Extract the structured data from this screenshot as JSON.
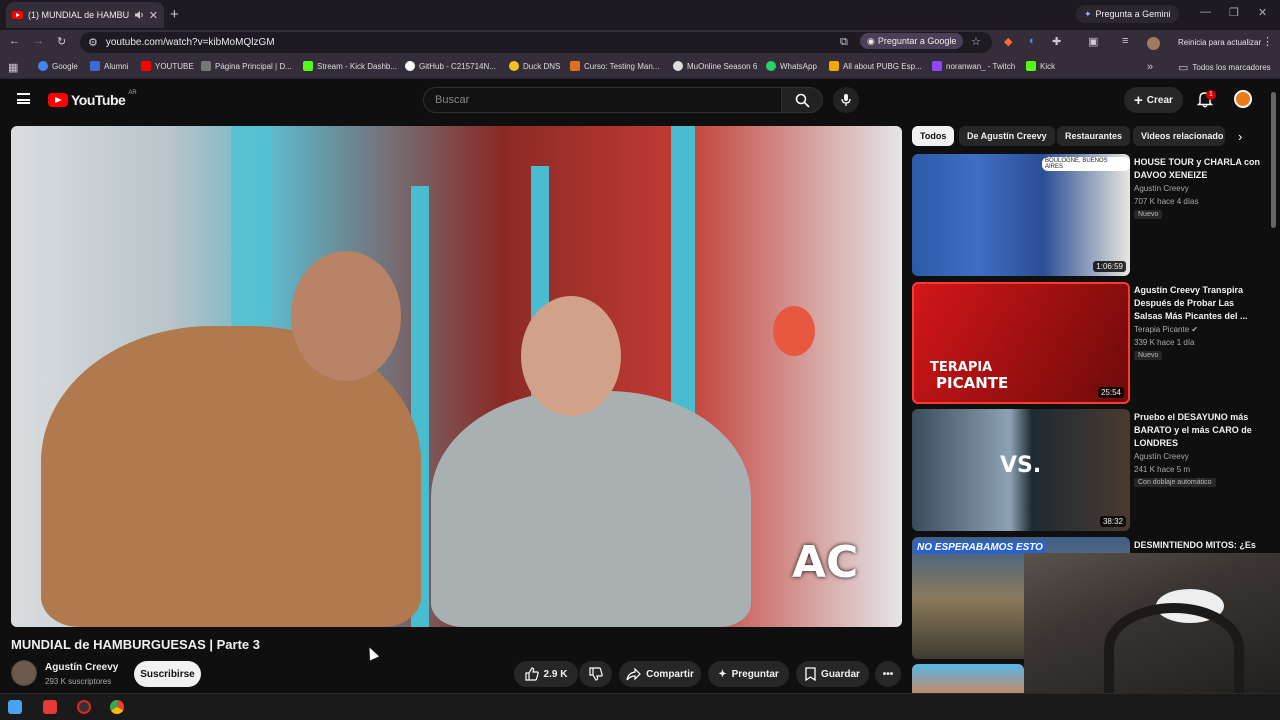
{
  "browser": {
    "tab_title": "(1) MUNDIAL de HAMBURG",
    "new_tab_icon": "plus-icon",
    "gemini_label": "Pregunta a Gemini",
    "url": "youtube.com/watch?v=kibMoMQlzGM",
    "ask_google_label": "Preguntar a Google",
    "update_label": "Reinicia para actualizar",
    "bookmarks": [
      "Google",
      "Alumni",
      "YOUTUBE",
      "Página Principal | D...",
      "Stream - Kick Dashb...",
      "GitHub - C215714N...",
      "Duck DNS",
      "Curso: Testing Man...",
      "MuOnline Season 6",
      "WhatsApp",
      "All about PUBG Esp...",
      "noranwan_ - Twitch",
      "Kick"
    ],
    "all_bookmarks_label": "Todos los marcadores",
    "bookmark_colors": [
      "#4285f4",
      "#3b6bd6",
      "#ff0000",
      "#777777",
      "#53fc18",
      "#ffffff",
      "#f0c020",
      "#e07020",
      "#dddddd",
      "#25d366",
      "#f2a900",
      "#9146ff",
      "#53fc18"
    ]
  },
  "youtube": {
    "logo_text": "YouTube",
    "country_code": "AR",
    "search_placeholder": "Buscar",
    "create_label": "Crear",
    "notification_count": "1",
    "video_title": "MUNDIAL de HAMBURGUESAS | Parte 3",
    "channel_name": "Agustín Creevy",
    "subscribers": "293 K suscriptores",
    "subscribe_label": "Suscribirse",
    "like_count": "2.9 K",
    "share_label": "Compartir",
    "ask_label": "Preguntar",
    "save_label": "Guardar",
    "chips": [
      "Todos",
      "De Agustín Creevy",
      "Restaurantes",
      "Videos relacionado"
    ],
    "related": [
      {
        "title": "HOUSE TOUR y CHARLA con DAVOO XENEIZE",
        "channel": "Agustín Creevy",
        "meta": "707 K  hace 4 días",
        "badge": "Nuevo",
        "duration": "1:06:59",
        "location": "BOULOGNE, BUENOS AIRES"
      },
      {
        "title": "Agustín Creevy Transpira Después de Probar Las Salsas Más Picantes del ...",
        "channel": "Terapia Picante",
        "meta": "339 K  hace 1 día",
        "badge": "Nuevo",
        "duration": "25:54",
        "thumb_text_1": "TERAPIA",
        "thumb_text_2": "PICANTE"
      },
      {
        "title": "Pruebo el DESAYUNO más BARATO y el más CARO de LONDRES",
        "channel": "Agustín Creevy",
        "meta": "241 K  hace 5 m",
        "badge": "Con doblaje automático",
        "duration": "38:32",
        "thumb_text_1": "VS."
      },
      {
        "title": "DESMINTIENDO MITOS: ¿Es",
        "thumb_text_1": "NO ESPERABAMOS ESTO"
      }
    ]
  }
}
